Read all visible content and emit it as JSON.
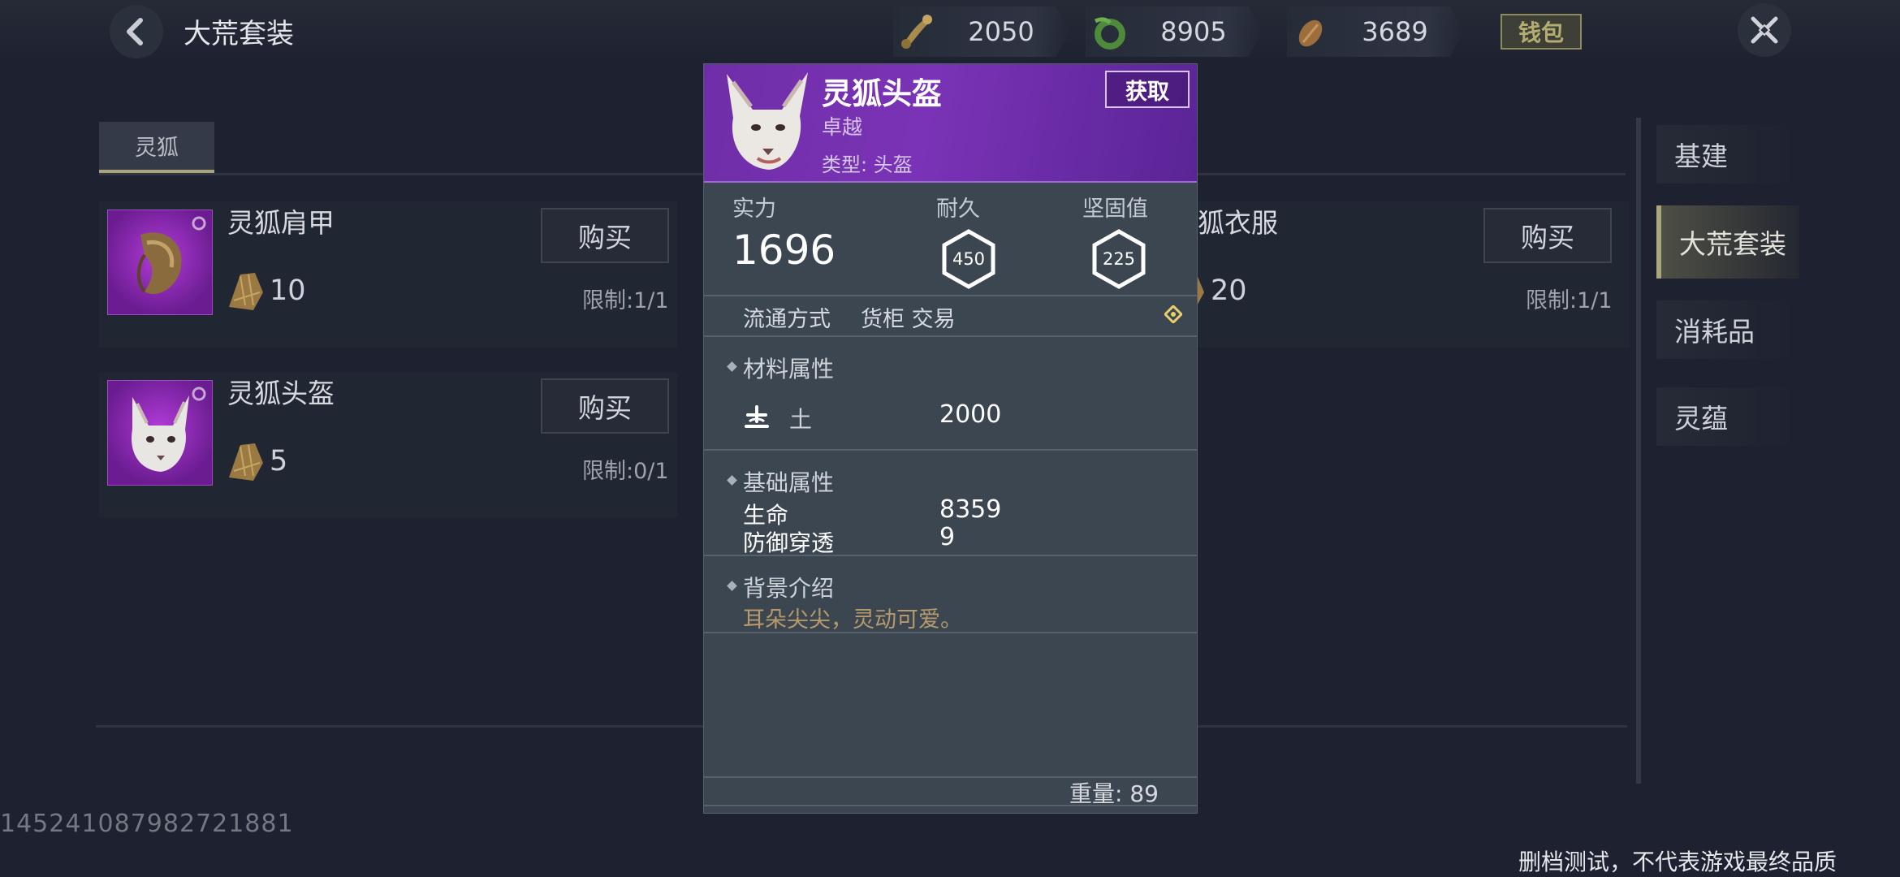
{
  "header": {
    "title": "大荒套装",
    "currencies": [
      {
        "icon": "bone-icon",
        "value": "2050"
      },
      {
        "icon": "jade-ring-icon",
        "value": "8905"
      },
      {
        "icon": "seed-icon",
        "value": "3689"
      }
    ],
    "wallet_label": "钱包"
  },
  "tabs": [
    {
      "label": "灵狐"
    }
  ],
  "items": [
    {
      "name": "灵狐肩甲",
      "price": "10",
      "buy_label": "购买",
      "limit": "限制:1/1"
    },
    {
      "name": "灵狐头盔",
      "price": "5",
      "buy_label": "购买",
      "limit": "限制:0/1"
    },
    {
      "name": "狐衣服",
      "price": "20",
      "buy_label": "购买",
      "limit": "限制:1/1"
    }
  ],
  "nav": [
    {
      "label": "基建"
    },
    {
      "label": "大荒套装",
      "active": true
    },
    {
      "label": "消耗品"
    },
    {
      "label": "灵蕴"
    }
  ],
  "popup": {
    "title": "灵狐头盔",
    "rarity": "卓越",
    "type": "类型: 头盔",
    "get_label": "获取",
    "stats": {
      "strength_label": "实力",
      "strength_value": "1696",
      "durability_label": "耐久",
      "durability_value": "450",
      "toughness_label": "坚固值",
      "toughness_value": "225"
    },
    "circulation": {
      "label": "流通方式",
      "value": "货柜 交易"
    },
    "material": {
      "title": "材料属性",
      "name": "土",
      "value": "2000"
    },
    "base": {
      "title": "基础属性",
      "rows": [
        {
          "label": "生命",
          "value": "8359"
        },
        {
          "label": "防御穿透",
          "value": "9"
        }
      ]
    },
    "background": {
      "title": "背景介绍",
      "text": "耳朵尖尖，灵动可爱。"
    },
    "weight": "重量: 89"
  },
  "footer": {
    "uid": "14524108798272188​1",
    "disclaimer": "删档测试，不代表游戏最终品质"
  },
  "colors": {
    "accent": "#a9a57c",
    "popup_header": "#7a33b6",
    "bg_text": "#b79a6b"
  }
}
